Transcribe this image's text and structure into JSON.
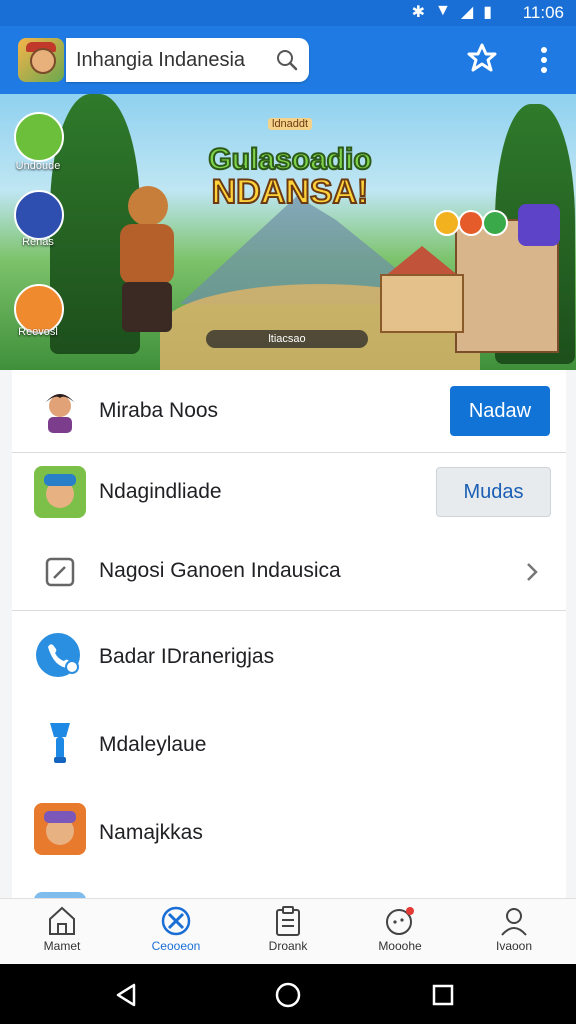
{
  "status_bar": {
    "time": "11:06"
  },
  "header": {
    "search": {
      "query": "Inhangia Indanesia"
    }
  },
  "hero": {
    "title_line1": "Gulasoadio",
    "title_line2": "NDANSA!",
    "tiny_label": "ldnaddt",
    "caption": "ltiacsao",
    "side_buttons": [
      {
        "label": "Undoude",
        "color": "#6cbf3a"
      },
      {
        "label": "Renas",
        "color": "#2f4fb0"
      },
      {
        "label": "Reevosl",
        "color": "#f08a2e"
      }
    ]
  },
  "list": {
    "items": [
      {
        "label": "Miraba Noos",
        "action": "Nadaw"
      },
      {
        "label": "Ndagindliade",
        "action": "Mudas"
      },
      {
        "label": "Nagosi Ganoen Indausica"
      },
      {
        "label": "Badar IDranerigjas"
      },
      {
        "label": "Mdaleylaue"
      },
      {
        "label": "Namajkkas"
      }
    ]
  },
  "bottom_nav": {
    "items": [
      {
        "label": "Mamet",
        "icon": "home-icon"
      },
      {
        "label": "Ceooeon",
        "icon": "compass-icon",
        "active": true
      },
      {
        "label": "Droank",
        "icon": "clipboard-icon"
      },
      {
        "label": "Mooohe",
        "icon": "chat-bubble-icon"
      },
      {
        "label": "Ivaoon",
        "icon": "profile-icon"
      }
    ]
  },
  "colors": {
    "primary": "#1f7be3",
    "statusbar": "#1a6fd6",
    "button": "#1273d6"
  }
}
